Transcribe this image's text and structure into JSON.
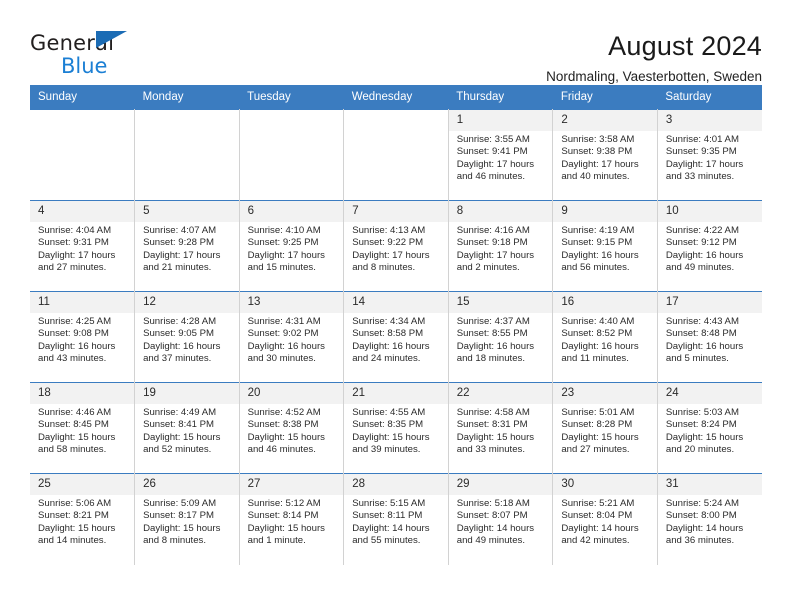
{
  "brand": {
    "line1": "General",
    "line2": "Blue",
    "triangle_color": "#1b6cb5",
    "line2_color": "#1b7fd4"
  },
  "header": {
    "title": "August 2024",
    "subtitle": "Nordmaling, Vaesterbotten, Sweden"
  },
  "colors": {
    "header_bar": "#3b7cc0",
    "daynum_band": "#f2f2f2",
    "cell_border": "#d2d2d2",
    "text": "#2b2b2b"
  },
  "weekdays": [
    "Sunday",
    "Monday",
    "Tuesday",
    "Wednesday",
    "Thursday",
    "Friday",
    "Saturday"
  ],
  "weeks": [
    [
      {
        "day": "",
        "blank": true
      },
      {
        "day": "",
        "blank": true
      },
      {
        "day": "",
        "blank": true
      },
      {
        "day": "",
        "blank": true
      },
      {
        "day": "1",
        "sunrise": "Sunrise: 3:55 AM",
        "sunset": "Sunset: 9:41 PM",
        "daylight1": "Daylight: 17 hours",
        "daylight2": "and 46 minutes."
      },
      {
        "day": "2",
        "sunrise": "Sunrise: 3:58 AM",
        "sunset": "Sunset: 9:38 PM",
        "daylight1": "Daylight: 17 hours",
        "daylight2": "and 40 minutes."
      },
      {
        "day": "3",
        "sunrise": "Sunrise: 4:01 AM",
        "sunset": "Sunset: 9:35 PM",
        "daylight1": "Daylight: 17 hours",
        "daylight2": "and 33 minutes."
      }
    ],
    [
      {
        "day": "4",
        "sunrise": "Sunrise: 4:04 AM",
        "sunset": "Sunset: 9:31 PM",
        "daylight1": "Daylight: 17 hours",
        "daylight2": "and 27 minutes."
      },
      {
        "day": "5",
        "sunrise": "Sunrise: 4:07 AM",
        "sunset": "Sunset: 9:28 PM",
        "daylight1": "Daylight: 17 hours",
        "daylight2": "and 21 minutes."
      },
      {
        "day": "6",
        "sunrise": "Sunrise: 4:10 AM",
        "sunset": "Sunset: 9:25 PM",
        "daylight1": "Daylight: 17 hours",
        "daylight2": "and 15 minutes."
      },
      {
        "day": "7",
        "sunrise": "Sunrise: 4:13 AM",
        "sunset": "Sunset: 9:22 PM",
        "daylight1": "Daylight: 17 hours",
        "daylight2": "and 8 minutes."
      },
      {
        "day": "8",
        "sunrise": "Sunrise: 4:16 AM",
        "sunset": "Sunset: 9:18 PM",
        "daylight1": "Daylight: 17 hours",
        "daylight2": "and 2 minutes."
      },
      {
        "day": "9",
        "sunrise": "Sunrise: 4:19 AM",
        "sunset": "Sunset: 9:15 PM",
        "daylight1": "Daylight: 16 hours",
        "daylight2": "and 56 minutes."
      },
      {
        "day": "10",
        "sunrise": "Sunrise: 4:22 AM",
        "sunset": "Sunset: 9:12 PM",
        "daylight1": "Daylight: 16 hours",
        "daylight2": "and 49 minutes."
      }
    ],
    [
      {
        "day": "11",
        "sunrise": "Sunrise: 4:25 AM",
        "sunset": "Sunset: 9:08 PM",
        "daylight1": "Daylight: 16 hours",
        "daylight2": "and 43 minutes."
      },
      {
        "day": "12",
        "sunrise": "Sunrise: 4:28 AM",
        "sunset": "Sunset: 9:05 PM",
        "daylight1": "Daylight: 16 hours",
        "daylight2": "and 37 minutes."
      },
      {
        "day": "13",
        "sunrise": "Sunrise: 4:31 AM",
        "sunset": "Sunset: 9:02 PM",
        "daylight1": "Daylight: 16 hours",
        "daylight2": "and 30 minutes."
      },
      {
        "day": "14",
        "sunrise": "Sunrise: 4:34 AM",
        "sunset": "Sunset: 8:58 PM",
        "daylight1": "Daylight: 16 hours",
        "daylight2": "and 24 minutes."
      },
      {
        "day": "15",
        "sunrise": "Sunrise: 4:37 AM",
        "sunset": "Sunset: 8:55 PM",
        "daylight1": "Daylight: 16 hours",
        "daylight2": "and 18 minutes."
      },
      {
        "day": "16",
        "sunrise": "Sunrise: 4:40 AM",
        "sunset": "Sunset: 8:52 PM",
        "daylight1": "Daylight: 16 hours",
        "daylight2": "and 11 minutes."
      },
      {
        "day": "17",
        "sunrise": "Sunrise: 4:43 AM",
        "sunset": "Sunset: 8:48 PM",
        "daylight1": "Daylight: 16 hours",
        "daylight2": "and 5 minutes."
      }
    ],
    [
      {
        "day": "18",
        "sunrise": "Sunrise: 4:46 AM",
        "sunset": "Sunset: 8:45 PM",
        "daylight1": "Daylight: 15 hours",
        "daylight2": "and 58 minutes."
      },
      {
        "day": "19",
        "sunrise": "Sunrise: 4:49 AM",
        "sunset": "Sunset: 8:41 PM",
        "daylight1": "Daylight: 15 hours",
        "daylight2": "and 52 minutes."
      },
      {
        "day": "20",
        "sunrise": "Sunrise: 4:52 AM",
        "sunset": "Sunset: 8:38 PM",
        "daylight1": "Daylight: 15 hours",
        "daylight2": "and 46 minutes."
      },
      {
        "day": "21",
        "sunrise": "Sunrise: 4:55 AM",
        "sunset": "Sunset: 8:35 PM",
        "daylight1": "Daylight: 15 hours",
        "daylight2": "and 39 minutes."
      },
      {
        "day": "22",
        "sunrise": "Sunrise: 4:58 AM",
        "sunset": "Sunset: 8:31 PM",
        "daylight1": "Daylight: 15 hours",
        "daylight2": "and 33 minutes."
      },
      {
        "day": "23",
        "sunrise": "Sunrise: 5:01 AM",
        "sunset": "Sunset: 8:28 PM",
        "daylight1": "Daylight: 15 hours",
        "daylight2": "and 27 minutes."
      },
      {
        "day": "24",
        "sunrise": "Sunrise: 5:03 AM",
        "sunset": "Sunset: 8:24 PM",
        "daylight1": "Daylight: 15 hours",
        "daylight2": "and 20 minutes."
      }
    ],
    [
      {
        "day": "25",
        "sunrise": "Sunrise: 5:06 AM",
        "sunset": "Sunset: 8:21 PM",
        "daylight1": "Daylight: 15 hours",
        "daylight2": "and 14 minutes."
      },
      {
        "day": "26",
        "sunrise": "Sunrise: 5:09 AM",
        "sunset": "Sunset: 8:17 PM",
        "daylight1": "Daylight: 15 hours",
        "daylight2": "and 8 minutes."
      },
      {
        "day": "27",
        "sunrise": "Sunrise: 5:12 AM",
        "sunset": "Sunset: 8:14 PM",
        "daylight1": "Daylight: 15 hours",
        "daylight2": "and 1 minute."
      },
      {
        "day": "28",
        "sunrise": "Sunrise: 5:15 AM",
        "sunset": "Sunset: 8:11 PM",
        "daylight1": "Daylight: 14 hours",
        "daylight2": "and 55 minutes."
      },
      {
        "day": "29",
        "sunrise": "Sunrise: 5:18 AM",
        "sunset": "Sunset: 8:07 PM",
        "daylight1": "Daylight: 14 hours",
        "daylight2": "and 49 minutes."
      },
      {
        "day": "30",
        "sunrise": "Sunrise: 5:21 AM",
        "sunset": "Sunset: 8:04 PM",
        "daylight1": "Daylight: 14 hours",
        "daylight2": "and 42 minutes."
      },
      {
        "day": "31",
        "sunrise": "Sunrise: 5:24 AM",
        "sunset": "Sunset: 8:00 PM",
        "daylight1": "Daylight: 14 hours",
        "daylight2": "and 36 minutes."
      }
    ]
  ]
}
